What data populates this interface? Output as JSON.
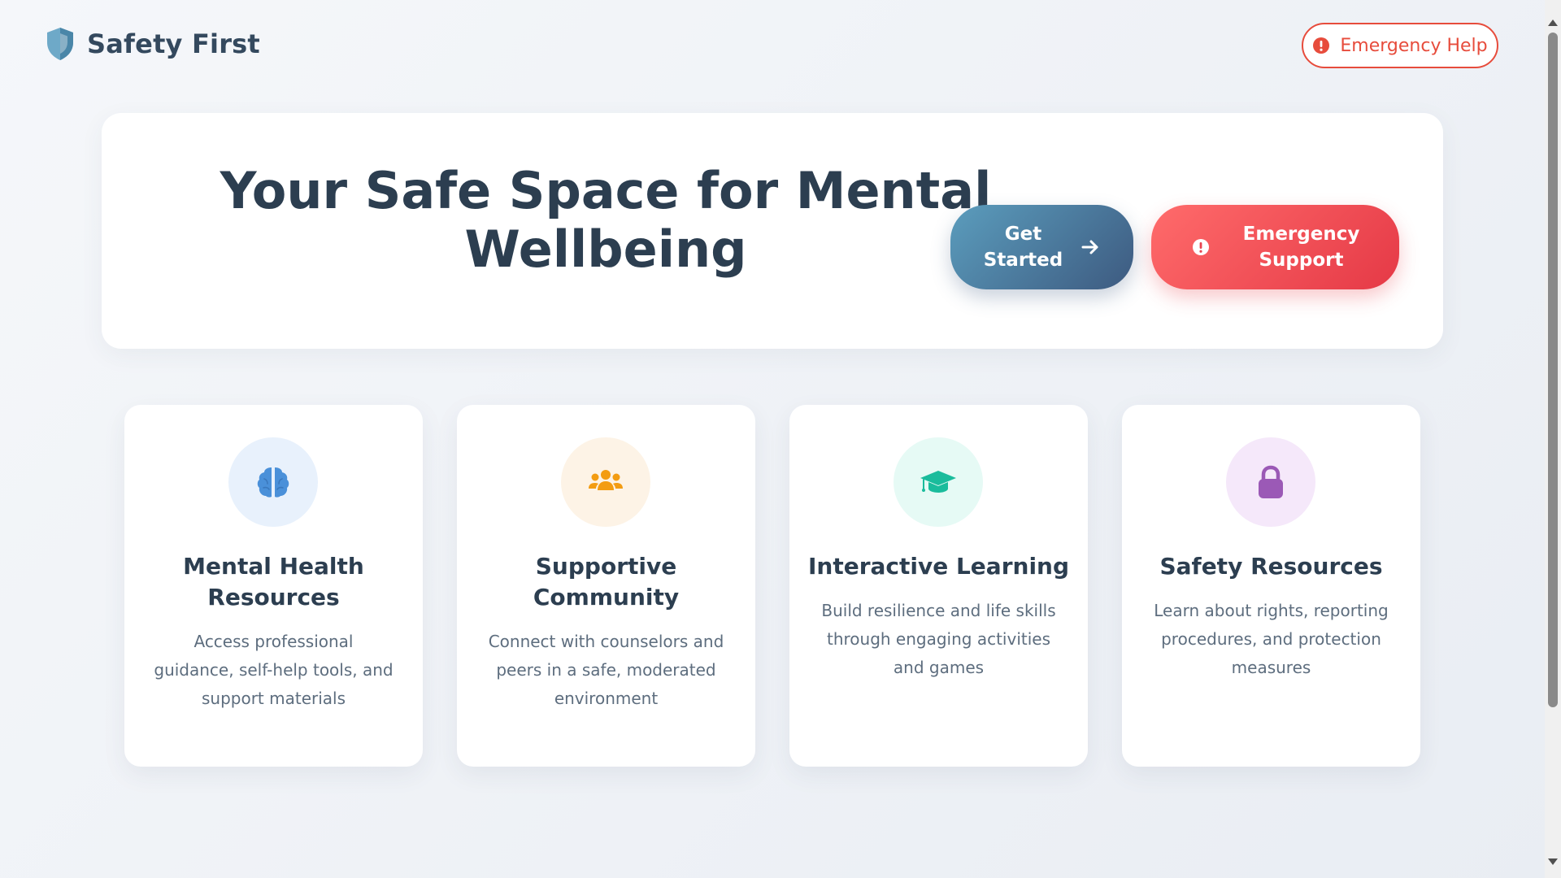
{
  "header": {
    "logo_icon": "shield-icon",
    "logo_text": "Safety First",
    "emergency_help_label": "Emergency Help",
    "emergency_help_icon": "alert-circle-icon"
  },
  "hero": {
    "title": "Your Safe Space for Mental Wellbeing",
    "get_started_label": "Get\nStarted",
    "get_started_icon": "arrow-right-icon",
    "emergency_support_label": "Emergency\nSupport",
    "emergency_support_icon": "alert-circle-icon"
  },
  "cards": [
    {
      "icon": "brain-icon",
      "title": "Mental Health Resources",
      "description": "Access professional guidance, self-help tools, and support materials",
      "accent": "#4a90d9",
      "bg": "#e8f1fc"
    },
    {
      "icon": "users-icon",
      "title": "Supportive Community",
      "description": "Connect with counselors and peers in a safe, moderated environment",
      "accent": "#f39c12",
      "bg": "#fdf3e6"
    },
    {
      "icon": "graduation-cap-icon",
      "title": "Interactive Learning",
      "description": "Build resilience and life skills through engaging activities and games",
      "accent": "#1abc9c",
      "bg": "#e6faf5"
    },
    {
      "icon": "lock-icon",
      "title": "Safety Resources",
      "description": "Learn about rights, reporting procedures, and protection measures",
      "accent": "#9b59b6",
      "bg": "#f5e8fa"
    }
  ],
  "colors": {
    "primary": "#3d5a80",
    "danger": "#e74c3c",
    "text": "#2c3e50",
    "muted": "#5d6d7e"
  }
}
